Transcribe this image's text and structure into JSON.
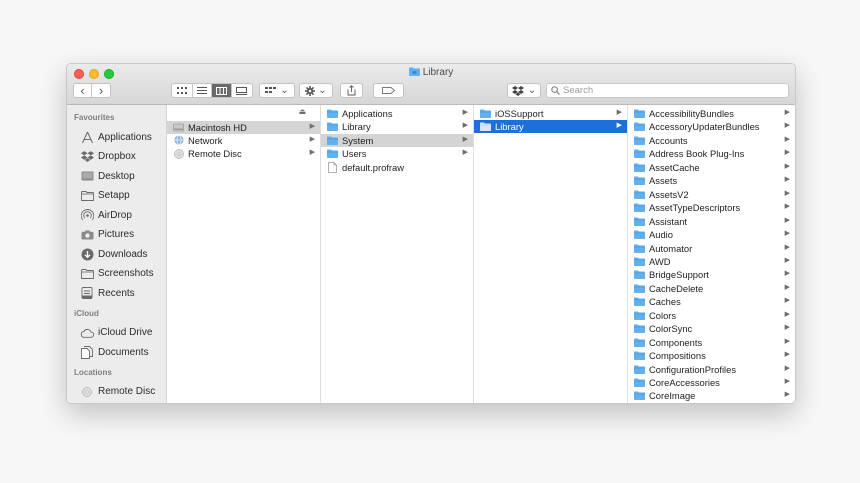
{
  "window": {
    "title": "Library"
  },
  "toolbar": {
    "back_glyph": "‹",
    "forward_glyph": "›",
    "view_icons": [
      "icon-view-icon",
      "list-view-icon",
      "column-view-icon",
      "gallery-view-icon"
    ],
    "group_glyph": "⌄",
    "action_glyph": "⌄",
    "dropbox_glyph": "⌄"
  },
  "search": {
    "placeholder": "Search"
  },
  "sidebar": {
    "sections": [
      {
        "title": "Favourites",
        "items": [
          {
            "label": "Applications",
            "icon": "applications-icon"
          },
          {
            "label": "Dropbox",
            "icon": "dropbox-icon"
          },
          {
            "label": "Desktop",
            "icon": "desktop-icon"
          },
          {
            "label": "Setapp",
            "icon": "folder-icon"
          },
          {
            "label": "AirDrop",
            "icon": "airdrop-icon"
          },
          {
            "label": "Pictures",
            "icon": "camera-icon"
          },
          {
            "label": "Downloads",
            "icon": "download-icon"
          },
          {
            "label": "Screenshots",
            "icon": "folder-icon"
          },
          {
            "label": "Recents",
            "icon": "recents-icon"
          }
        ]
      },
      {
        "title": "iCloud",
        "items": [
          {
            "label": "iCloud Drive",
            "icon": "cloud-icon"
          },
          {
            "label": "Documents",
            "icon": "documents-icon"
          }
        ]
      },
      {
        "title": "Locations",
        "items": [
          {
            "label": "Remote Disc",
            "icon": "disc-icon"
          }
        ]
      }
    ]
  },
  "columns": [
    {
      "items": [
        {
          "label": "Macintosh HD",
          "icon": "harddrive-icon",
          "arrow": true,
          "state": "gray"
        },
        {
          "label": "Network",
          "icon": "network-icon",
          "arrow": true,
          "state": ""
        },
        {
          "label": "Remote Disc",
          "icon": "disc-icon",
          "arrow": true,
          "state": ""
        }
      ]
    },
    {
      "items": [
        {
          "label": "Applications",
          "icon": "folder-icon",
          "arrow": true,
          "state": ""
        },
        {
          "label": "Library",
          "icon": "folder-icon",
          "arrow": true,
          "state": ""
        },
        {
          "label": "System",
          "icon": "folder-icon",
          "arrow": true,
          "state": "gray"
        },
        {
          "label": "Users",
          "icon": "folder-icon",
          "arrow": true,
          "state": ""
        },
        {
          "label": "default.profraw",
          "icon": "file-icon",
          "arrow": false,
          "state": ""
        }
      ]
    },
    {
      "items": [
        {
          "label": "iOSSupport",
          "icon": "folder-icon",
          "arrow": true,
          "state": ""
        },
        {
          "label": "Library",
          "icon": "folder-icon",
          "arrow": true,
          "state": "blue"
        }
      ]
    },
    {
      "items": [
        {
          "label": "AccessibilityBundles",
          "icon": "folder-icon",
          "arrow": true,
          "state": ""
        },
        {
          "label": "AccessoryUpdaterBundles",
          "icon": "folder-icon",
          "arrow": true,
          "state": ""
        },
        {
          "label": "Accounts",
          "icon": "folder-icon",
          "arrow": true,
          "state": ""
        },
        {
          "label": "Address Book Plug-Ins",
          "icon": "folder-icon",
          "arrow": true,
          "state": ""
        },
        {
          "label": "AssetCache",
          "icon": "folder-icon",
          "arrow": true,
          "state": ""
        },
        {
          "label": "Assets",
          "icon": "folder-icon",
          "arrow": true,
          "state": ""
        },
        {
          "label": "AssetsV2",
          "icon": "folder-icon",
          "arrow": true,
          "state": ""
        },
        {
          "label": "AssetTypeDescriptors",
          "icon": "folder-icon",
          "arrow": true,
          "state": ""
        },
        {
          "label": "Assistant",
          "icon": "folder-icon",
          "arrow": true,
          "state": ""
        },
        {
          "label": "Audio",
          "icon": "folder-icon",
          "arrow": true,
          "state": ""
        },
        {
          "label": "Automator",
          "icon": "folder-icon",
          "arrow": true,
          "state": ""
        },
        {
          "label": "AWD",
          "icon": "folder-icon",
          "arrow": true,
          "state": ""
        },
        {
          "label": "BridgeSupport",
          "icon": "folder-icon",
          "arrow": true,
          "state": ""
        },
        {
          "label": "CacheDelete",
          "icon": "folder-icon",
          "arrow": true,
          "state": ""
        },
        {
          "label": "Caches",
          "icon": "folder-icon",
          "arrow": true,
          "state": ""
        },
        {
          "label": "Colors",
          "icon": "folder-icon",
          "arrow": true,
          "state": ""
        },
        {
          "label": "ColorSync",
          "icon": "folder-icon",
          "arrow": true,
          "state": ""
        },
        {
          "label": "Components",
          "icon": "folder-icon",
          "arrow": true,
          "state": ""
        },
        {
          "label": "Compositions",
          "icon": "folder-icon",
          "arrow": true,
          "state": ""
        },
        {
          "label": "ConfigurationProfiles",
          "icon": "folder-icon",
          "arrow": true,
          "state": ""
        },
        {
          "label": "CoreAccessories",
          "icon": "folder-icon",
          "arrow": true,
          "state": ""
        },
        {
          "label": "CoreImage",
          "icon": "folder-icon",
          "arrow": true,
          "state": ""
        }
      ]
    }
  ],
  "colors": {
    "selection": "#1d6fd9",
    "folder": "#5fb0ef",
    "sidebar_bg": "#ececec"
  }
}
